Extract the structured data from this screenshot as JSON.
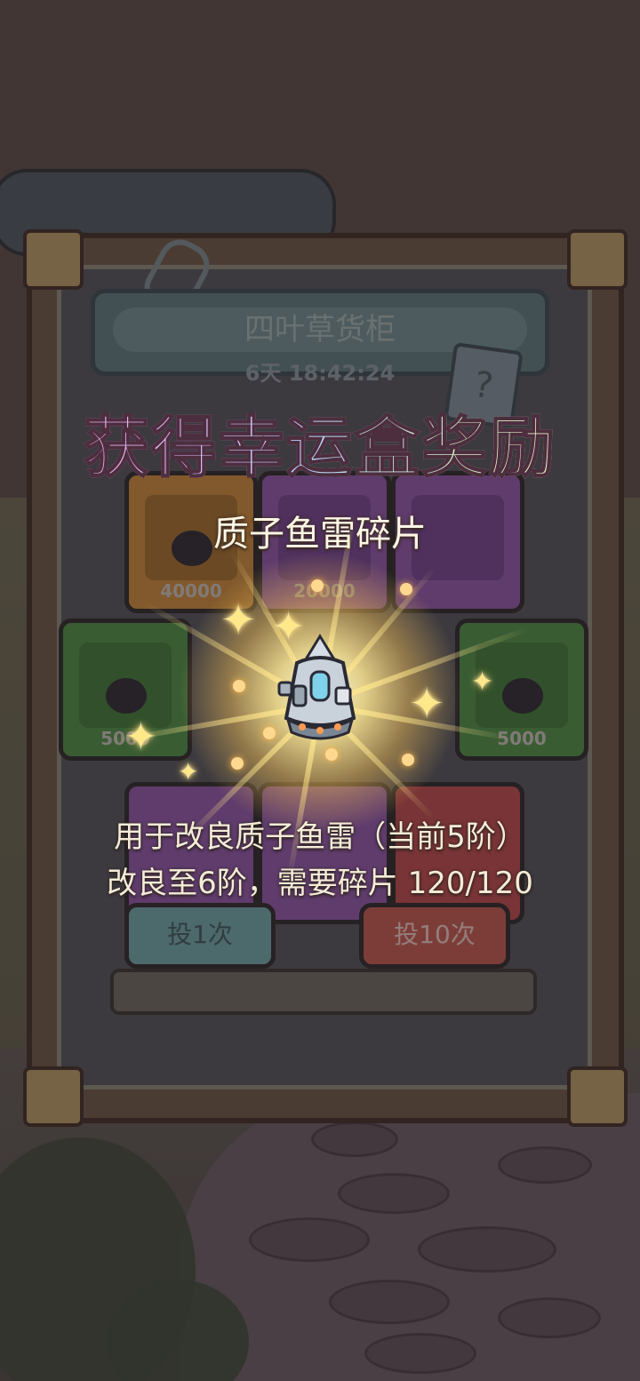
{
  "cabinet": {
    "title": "四叶草货柜",
    "timer": "6天  18:42:24",
    "boxes": [
      {
        "value": "40000",
        "color": "#c98a3a"
      },
      {
        "value": "20000",
        "color": "#8e59a8"
      },
      {
        "value": "",
        "color": "#8e59a8"
      },
      {
        "value": "5000",
        "color": "#4d8f45"
      },
      {
        "value": "5000",
        "color": "#4d8f45"
      }
    ],
    "buttons": {
      "single": "投1次",
      "ten": "投10次"
    }
  },
  "reward": {
    "headline": "获得幸运盒奖励",
    "item_name": "质子鱼雷碎片",
    "item_icon": "torpedo-capsule-icon",
    "desc_line1": "用于改良质子鱼雷（当前5阶）",
    "desc_line2": "改良至6阶，需要碎片  120/120",
    "fragments_current": 120,
    "fragments_required": 120
  }
}
